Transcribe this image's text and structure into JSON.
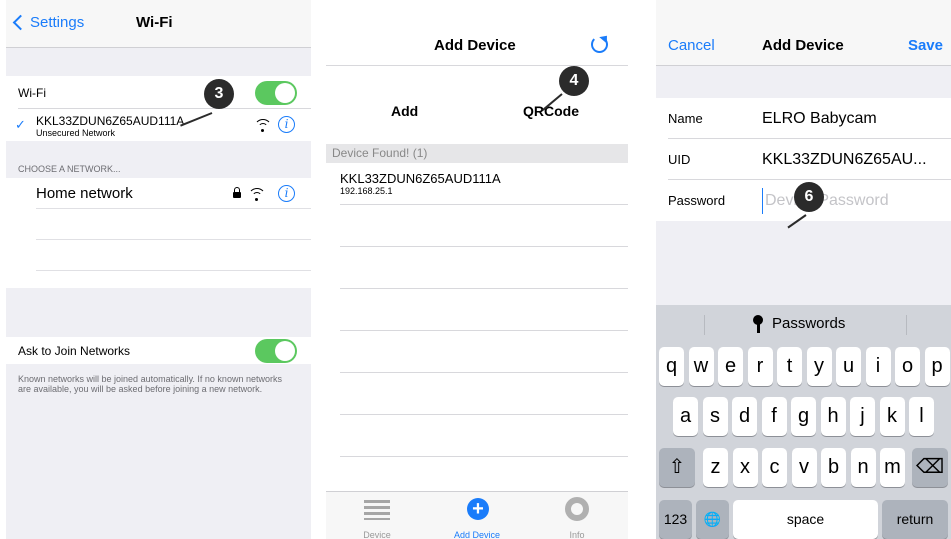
{
  "panel1": {
    "back_label": "Settings",
    "title": "Wi-Fi",
    "wifi_label": "Wi-Fi",
    "current_network": {
      "name": "KKL33ZDUN6Z65AUD111A",
      "status": "Unsecured Network"
    },
    "choose_header": "CHOOSE A NETWORK...",
    "networks": [
      {
        "name": "Home network"
      }
    ],
    "ask_label": "Ask to Join Networks",
    "ask_desc": "Known networks will be joined automatically. If no known networks are available, you will be asked before joining a new network.",
    "info_glyph": "i",
    "checkmark": "✓",
    "badge": "3"
  },
  "panel2": {
    "title": "Add Device",
    "tab_add": "Add",
    "tab_qr": "QRCode",
    "badge": "4",
    "found_header": "Device Found! (1)",
    "device": {
      "uid": "KKL33ZDUN6Z65AUD111A",
      "ip": "192.168.25.1"
    },
    "tabbar": {
      "device": "Device",
      "add_device": "Add Device",
      "info": "Info",
      "plus_glyph": "+"
    }
  },
  "panel3": {
    "cancel": "Cancel",
    "title": "Add Device",
    "save": "Save",
    "fields": {
      "name_label": "Name",
      "name_value": "ELRO Babycam",
      "uid_label": "UID",
      "uid_value": "KKL33ZDUN6Z65AU...",
      "password_label": "Password",
      "password_placeholder": "Device Password"
    },
    "badge": "6",
    "keyboard": {
      "bar_label": "Passwords",
      "row1": [
        "q",
        "w",
        "e",
        "r",
        "t",
        "y",
        "u",
        "i",
        "o",
        "p"
      ],
      "row2": [
        "a",
        "s",
        "d",
        "f",
        "g",
        "h",
        "j",
        "k",
        "l"
      ],
      "row3": [
        "z",
        "x",
        "c",
        "v",
        "b",
        "n",
        "m"
      ],
      "shift": "⇧",
      "backspace": "⌫",
      "numbers": "123",
      "globe": "🌐",
      "space": "space",
      "return": "return"
    }
  },
  "colors": {
    "accent": "#1a7cfa",
    "toggle_on": "#5bc85f",
    "badge": "#2b2b2b"
  }
}
